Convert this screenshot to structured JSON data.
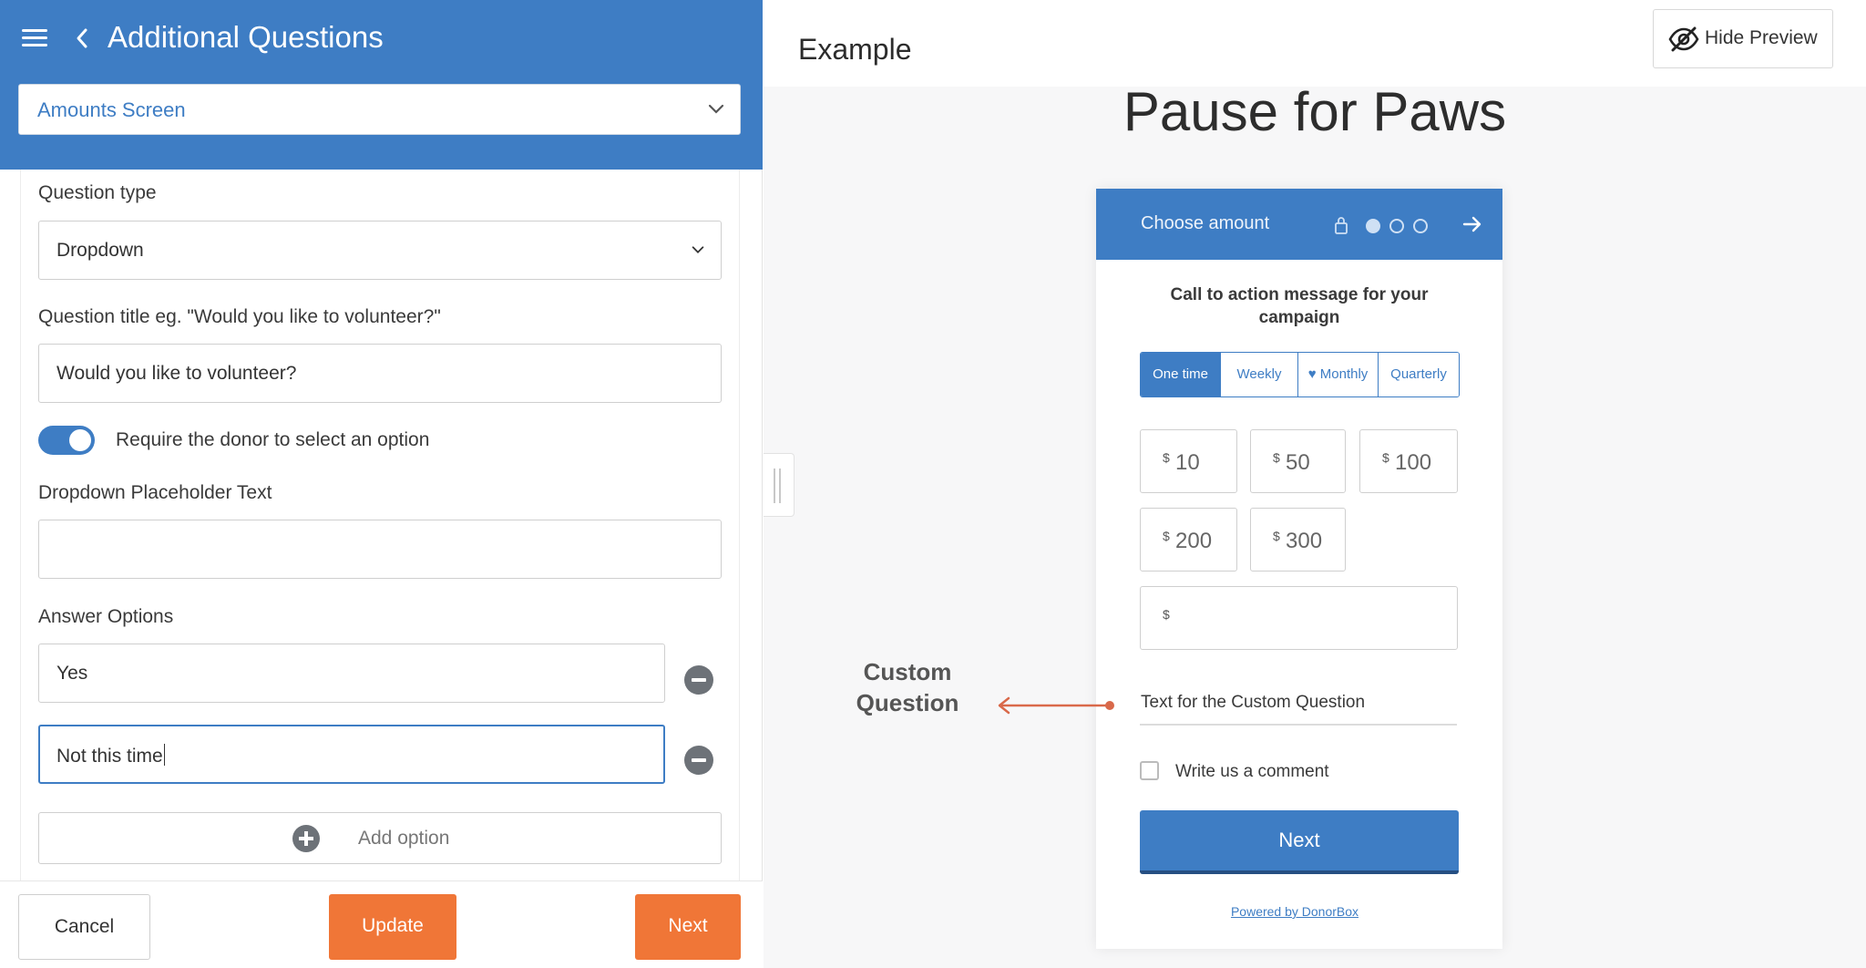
{
  "left": {
    "title": "Additional Questions",
    "screen_select": "Amounts Screen",
    "question_type_label": "Question type",
    "question_type_value": "Dropdown",
    "question_title_label": "Question title eg. \"Would you like to volunteer?\"",
    "question_title_value": "Would you like to volunteer?",
    "require_toggle_label": "Require the donor to select an option",
    "require_toggle_on": true,
    "placeholder_label": "Dropdown Placeholder Text",
    "placeholder_value": "",
    "answer_options_label": "Answer Options",
    "answer_options": [
      "Yes",
      "Not this time"
    ],
    "add_option_label": "Add option",
    "cancel_label": "Cancel",
    "update_label": "Update",
    "next_label": "Next"
  },
  "preview": {
    "example_label": "Example",
    "hide_preview_label": "Hide Preview",
    "campaign_title": "Pause for Paws",
    "widget": {
      "header_title": "Choose amount",
      "cta": "Call to action message for your campaign",
      "frequencies": [
        "One time",
        "Weekly",
        "Monthly",
        "Quarterly"
      ],
      "active_frequency": "One time",
      "currency_symbol": "$",
      "amounts": [
        "10",
        "50",
        "100",
        "200",
        "300"
      ],
      "custom_question_text": "Text for the Custom Question",
      "comment_label": "Write us a comment",
      "next_label": "Next",
      "powered_by": "Powered by DonorBox"
    },
    "annotation": "Custom Question"
  },
  "colors": {
    "primary": "#3e7dc4",
    "accent_orange": "#f07637",
    "annotation_arrow": "#d9694a"
  }
}
